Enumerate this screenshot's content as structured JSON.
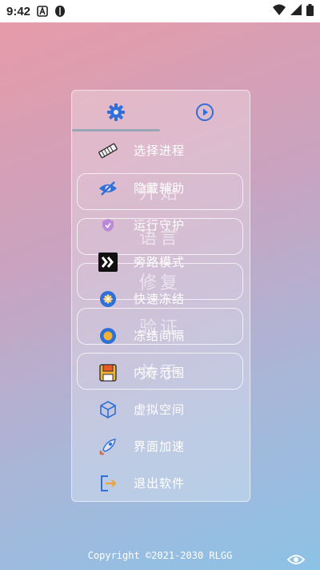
{
  "status_bar": {
    "time": "9:42"
  },
  "background_buttons": [
    {
      "label": "开始"
    },
    {
      "label": "语言"
    },
    {
      "label": "修复"
    },
    {
      "label": "验证"
    },
    {
      "label": "关于"
    }
  ],
  "menu": {
    "items": [
      {
        "label": "选择进程",
        "icon": "memory-chip-icon"
      },
      {
        "label": "隐藏辅助",
        "icon": "eye-off-icon"
      },
      {
        "label": "运行守护",
        "icon": "shield-icon"
      },
      {
        "label": "旁路模式",
        "icon": "double-chevron-icon"
      },
      {
        "label": "快速冻结",
        "icon": "snowflake-icon"
      },
      {
        "label": "冻结间隔",
        "icon": "interval-icon"
      },
      {
        "label": "内存范围",
        "icon": "save-icon"
      },
      {
        "label": "虚拟空间",
        "icon": "cube-icon"
      },
      {
        "label": "界面加速",
        "icon": "rocket-icon"
      },
      {
        "label": "退出软件",
        "icon": "exit-icon"
      }
    ]
  },
  "footer": {
    "copyright": "Copyright ©2021-2030 RLGG"
  },
  "colors": {
    "accent": "#2f6fd8",
    "panel_text": "#ffffff"
  }
}
